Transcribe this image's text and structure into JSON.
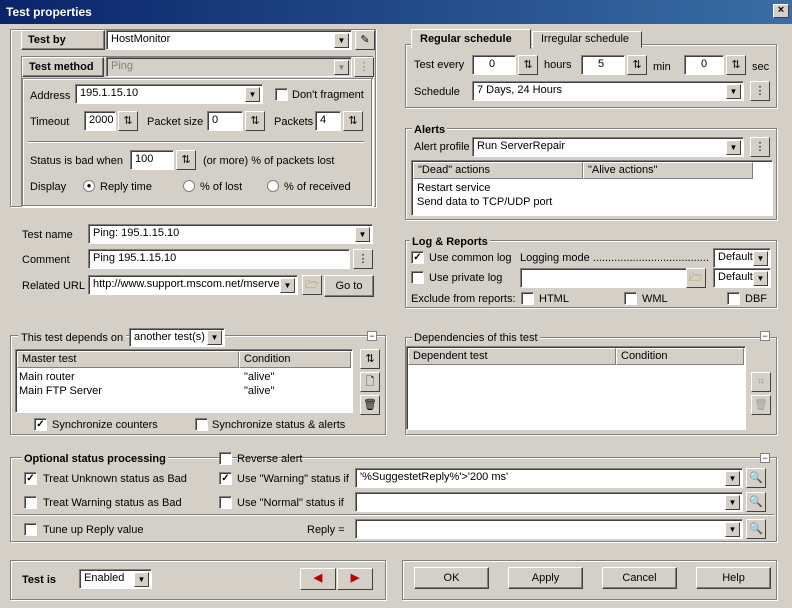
{
  "window": {
    "title": "Test properties",
    "close": "×"
  },
  "test_by": {
    "label": "Test by",
    "value": "HostMonitor"
  },
  "test_method": {
    "label": "Test method",
    "value": "Ping"
  },
  "address": {
    "label": "Address",
    "value": "195.1.15.10",
    "dont_fragment": "Don't fragment"
  },
  "timeout": {
    "label": "Timeout",
    "value": "2000",
    "packet_size_label": "Packet size",
    "packet_size": "0",
    "packets_label": "Packets",
    "packets": "4"
  },
  "status_bad": {
    "label": "Status is bad when",
    "value": "100",
    "suffix": "(or more) % of packets lost"
  },
  "display": {
    "label": "Display",
    "options": [
      "Reply time",
      "% of lost",
      "% of received"
    ]
  },
  "test_name": {
    "label": "Test name",
    "value": "Ping: 195.1.15.10"
  },
  "comment": {
    "label": "Comment",
    "value": "Ping 195.1.15.10"
  },
  "related_url": {
    "label": "Related URL",
    "value": "http://www.support.mscom.net/mserver",
    "go": "Go to"
  },
  "depends": {
    "label": "This test depends on",
    "value": "another test(s)",
    "col1": "Master test",
    "col2": "Condition",
    "rows": [
      {
        "master": "Main router",
        "cond": "\"alive\""
      },
      {
        "master": "Main FTP Server",
        "cond": "\"alive\""
      }
    ],
    "sync_counters": "Synchronize counters",
    "sync_status": "Synchronize status & alerts"
  },
  "schedule": {
    "tab1": "Regular schedule",
    "tab2": "Irregular schedule",
    "test_every": "Test every",
    "hours_val": "0",
    "hours": "hours",
    "min_val": "5",
    "min": "min",
    "sec_val": "0",
    "sec": "sec",
    "schedule_label": "Schedule",
    "schedule_value": "7 Days, 24 Hours"
  },
  "alerts": {
    "title": "Alerts",
    "profile_label": "Alert profile",
    "profile": "Run ServerRepair",
    "col1": "\"Dead\" actions",
    "col2": "\"Alive actions\"",
    "rows": [
      "Restart service",
      "Send data to TCP/UDP port"
    ]
  },
  "log": {
    "title": "Log & Reports",
    "use_common": "Use common log",
    "logging_mode": "Logging mode ......................................",
    "mode1": "Default",
    "use_private": "Use private log",
    "mode2": "Default",
    "exclude": "Exclude from reports:",
    "html": "HTML",
    "wml": "WML",
    "dbf": "DBF"
  },
  "deps": {
    "title": "Dependencies of this test",
    "col1": "Dependent test",
    "col2": "Condition"
  },
  "optional": {
    "title": "Optional status processing",
    "treat_unknown": "Treat Unknown status as Bad",
    "treat_warning": "Treat Warning status as Bad",
    "reverse": "Reverse alert",
    "use_warning": "Use \"Warning\" status if",
    "warning_expr": "'%SuggestetReply%'>'200 ms'",
    "use_normal": "Use \"Normal\" status if",
    "tune": "Tune up Reply value",
    "reply": "Reply ="
  },
  "footer": {
    "test_is": "Test is",
    "state": "Enabled",
    "ok": "OK",
    "apply": "Apply",
    "cancel": "Cancel",
    "help": "Help"
  }
}
